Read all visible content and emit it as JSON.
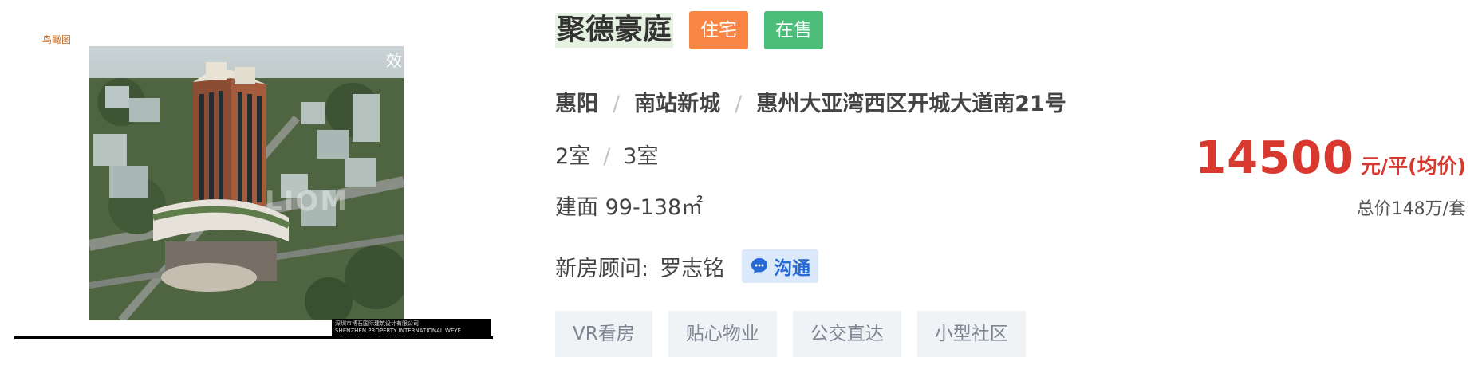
{
  "image": {
    "badge": "鸟瞰图",
    "watermark": "LIOM",
    "corner_glyph": "效",
    "caption_line1": "深圳市博石国际建筑设计有限公司",
    "caption_line2": "SHENZHEN PROPERTY INTERNATIONAL WEYE CONSTRUCTION DESIGN CO.LTD"
  },
  "listing": {
    "title": "聚德豪庭",
    "tags": [
      "住宅",
      "在售"
    ],
    "location": {
      "district": "惠阳",
      "area": "南站新城",
      "address": "惠州大亚湾西区开城大道南21号"
    },
    "rooms": [
      "2室",
      "3室"
    ],
    "floor_area": "建面 99-138㎡",
    "advisor_label": "新房顾问:",
    "advisor_name": "罗志铭",
    "chat_label": "沟通",
    "features": [
      "VR看房",
      "贴心物业",
      "公交直达",
      "小型社区"
    ],
    "price": {
      "value": "14500",
      "unit": "元/平(均价)",
      "total": "总价148万/套"
    }
  },
  "colors": {
    "tag_house": "#f98645",
    "tag_sale": "#4cbc79",
    "price": "#d9382f",
    "chat": "#2469d4"
  }
}
